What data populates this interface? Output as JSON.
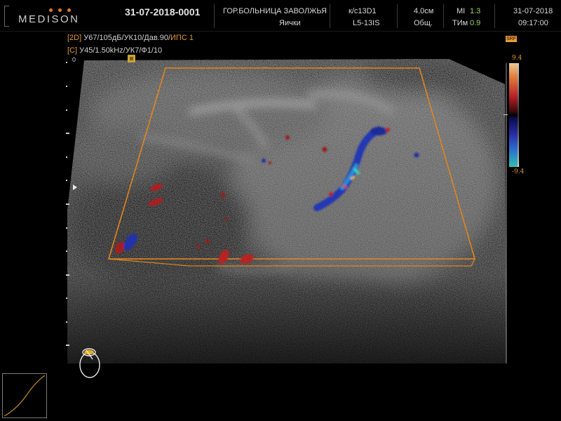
{
  "header": {
    "brand": "MEDISON",
    "brand_dot_colors": [
      "#e0782a",
      "#e0782a",
      "#e0782a"
    ],
    "patient_id": "31-07-2018-0001",
    "hospital": "ГОР.БОЛЬНИЦА ЗАВОЛЖЬЯ",
    "exam": "Яички",
    "probe_preset": "к/с13D1",
    "probe_name": "L5-13IS",
    "depth": "4.0см",
    "mode": "Общ.",
    "mi_label": "MI",
    "mi_value": "1.3",
    "tim_label": "ТИм",
    "tim_value": "0.9",
    "date": "31-07-2018",
    "time": "09:17:00"
  },
  "params": {
    "line_2d_tag": "[2D]",
    "line_2d_text": " У67/105дБ/УК10/Дав.90/",
    "line_2d_hi": "ИПС 1",
    "line_c_tag": "[C]",
    "line_c_text": " У45/1.50kHz/УК7/Ф1/10"
  },
  "depth_scale": {
    "zero_label": "0"
  },
  "color_bar": {
    "badge": "SRF",
    "max": "9.4",
    "min": "-9.4"
  },
  "icons": {
    "orientation": "orientation-marker-icon",
    "focus": "focus-arrow-icon",
    "body_marker": "body-marker-icon",
    "curve": "gray-map-curve-icon"
  },
  "colors": {
    "accent_orange": "#e39a34",
    "roi_box": "#e0851f",
    "value_green": "#9ed26b",
    "doppler_red": "#b8202a",
    "doppler_blue": "#2a2aa0"
  }
}
